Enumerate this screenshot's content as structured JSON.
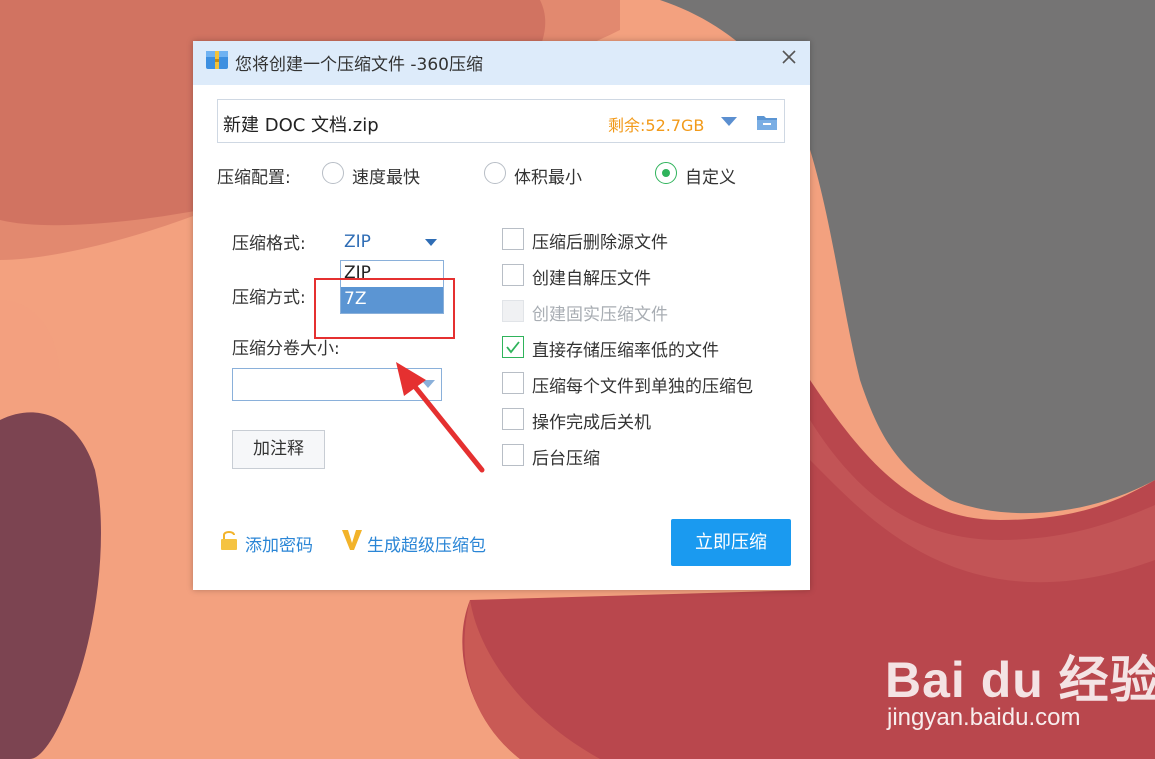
{
  "window": {
    "title": "您将创建一个压缩文件 -360压缩",
    "close_icon": "close-icon",
    "app_icon": "archive-icon"
  },
  "path": {
    "filename": "新建 DOC 文档.zip",
    "free_space": "剩余:52.7GB",
    "dropdown_icon": "triangle-down-icon",
    "folder_icon": "folder-icon"
  },
  "config": {
    "label": "压缩配置:",
    "options": [
      {
        "label": "速度最快",
        "checked": false
      },
      {
        "label": "体积最小",
        "checked": false
      },
      {
        "label": "自定义",
        "checked": true
      }
    ]
  },
  "format": {
    "label": "压缩格式:",
    "value": "ZIP",
    "options": [
      "ZIP",
      "7Z"
    ],
    "selected_index": 1
  },
  "method": {
    "label": "压缩方式:"
  },
  "volume": {
    "label": "压缩分卷大小:",
    "value": ""
  },
  "comment_button": "加注释",
  "checkboxes": [
    {
      "label": "压缩后删除源文件",
      "checked": false,
      "disabled": false
    },
    {
      "label": "创建自解压文件",
      "checked": false,
      "disabled": false
    },
    {
      "label": "创建固实压缩文件",
      "checked": false,
      "disabled": true
    },
    {
      "label": "直接存储压缩率低的文件",
      "checked": true,
      "disabled": false
    },
    {
      "label": "压缩每个文件到单独的压缩包",
      "checked": false,
      "disabled": false
    },
    {
      "label": "操作完成后关机",
      "checked": false,
      "disabled": false
    },
    {
      "label": "后台压缩",
      "checked": false,
      "disabled": false
    }
  ],
  "links": {
    "add_password": "添加密码",
    "super_package": "生成超级压缩包"
  },
  "compress_button": "立即压缩",
  "watermark": {
    "logo": "Bai du 经验",
    "url": "jingyan.baidu.com"
  },
  "colors": {
    "accent_blue": "#1a9af0",
    "title_bar": "#ddebfa",
    "free_space": "#f29a1a",
    "check_green": "#2fb35b",
    "annotation_red": "#e53030"
  }
}
